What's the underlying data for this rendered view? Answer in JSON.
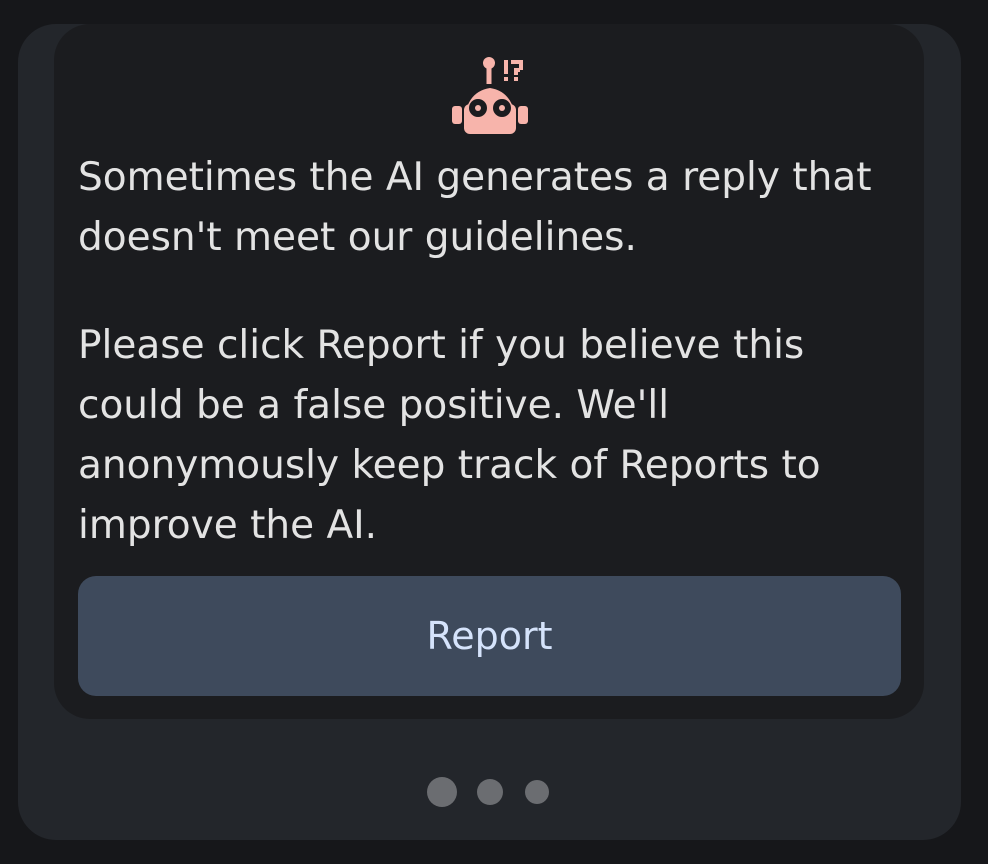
{
  "dialog": {
    "icon": "robot-alert-icon",
    "paragraph1": "Sometimes the AI generates a reply that doesn't meet our guidelines.",
    "paragraph2": "Please click Report if you believe this could be a false positive. We'll anonymously keep track of Reports to improve the AI.",
    "report_label": "Report"
  },
  "pager": {
    "pages": 3
  },
  "colors": {
    "accent_icon": "#f7b4ab",
    "button_bg": "#3e4a5c",
    "button_text": "#d5e3fb"
  }
}
